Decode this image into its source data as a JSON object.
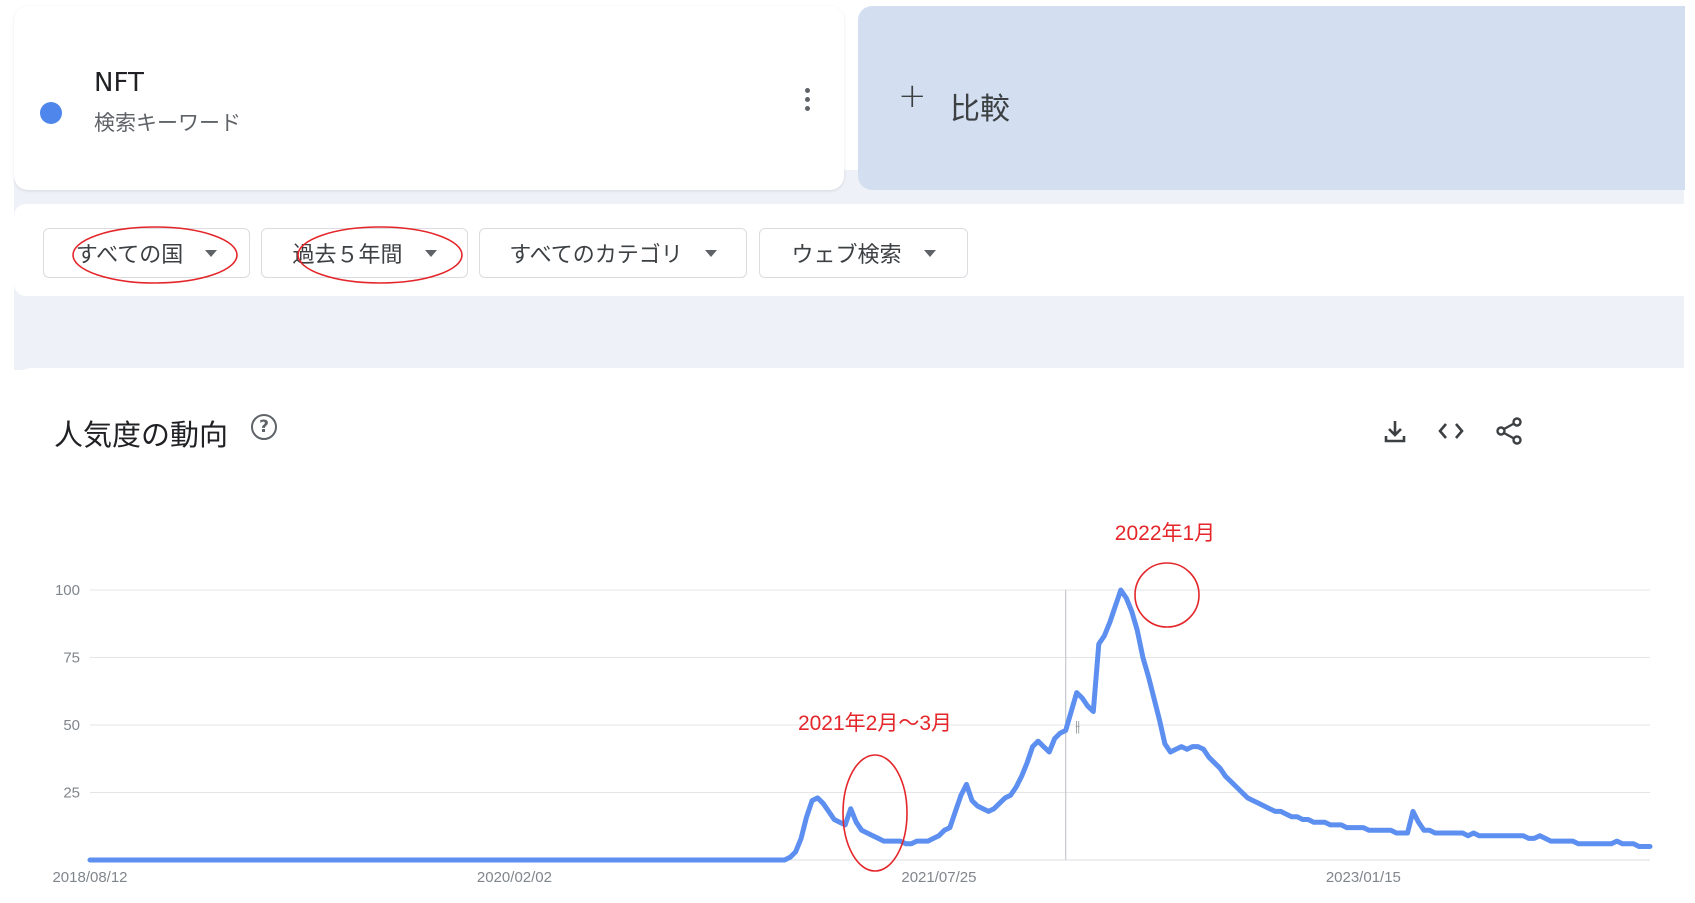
{
  "keyword": {
    "term": "NFT",
    "subtitle": "検索キーワード",
    "color": "#4f86ec",
    "menu_icon": "more-vert-icon"
  },
  "compare": {
    "plus": "+",
    "label": "比較"
  },
  "filters": [
    {
      "label": "すべての国"
    },
    {
      "label": "過去５年間"
    },
    {
      "label": "すべてのカテゴリ"
    },
    {
      "label": "ウェブ検索"
    }
  ],
  "chart_section": {
    "title": "人気度の動向",
    "help_icon": "help-circle-icon",
    "tools": [
      "download-icon",
      "embed-code-icon",
      "share-icon"
    ]
  },
  "annotations": {
    "peak_label": "2022年1月",
    "early_label": "2021年2月〜3月"
  },
  "chart_data": {
    "type": "line",
    "title": "",
    "xlabel": "",
    "ylabel": "",
    "ylim": [
      0,
      100
    ],
    "yticks": [
      25,
      50,
      75,
      100
    ],
    "xtick_labels": [
      "2018/08/12",
      "2020/02/02",
      "2021/07/25",
      "2023/01/15"
    ],
    "xtick_positions": [
      0,
      77,
      154,
      231
    ],
    "grid": true,
    "line_color": "#5d8ff0",
    "hover_marker_week": 177,
    "series": [
      {
        "values": [
          0,
          0,
          0,
          0,
          0,
          0,
          0,
          0,
          0,
          0,
          0,
          0,
          0,
          0,
          0,
          0,
          0,
          0,
          0,
          0,
          0,
          0,
          0,
          0,
          0,
          0,
          0,
          0,
          0,
          0,
          0,
          0,
          0,
          0,
          0,
          0,
          0,
          0,
          0,
          0,
          0,
          0,
          0,
          0,
          0,
          0,
          0,
          0,
          0,
          0,
          0,
          0,
          0,
          0,
          0,
          0,
          0,
          0,
          0,
          0,
          0,
          0,
          0,
          0,
          0,
          0,
          0,
          0,
          0,
          0,
          0,
          0,
          0,
          0,
          0,
          0,
          0,
          0,
          0,
          0,
          0,
          0,
          0,
          0,
          0,
          0,
          0,
          0,
          0,
          0,
          0,
          0,
          0,
          0,
          0,
          0,
          0,
          0,
          0,
          0,
          0,
          0,
          0,
          0,
          0,
          0,
          0,
          0,
          0,
          0,
          0,
          0,
          0,
          0,
          0,
          0,
          0,
          0,
          0,
          0,
          0,
          0,
          0,
          0,
          0,
          0,
          0,
          1,
          3,
          8,
          16,
          22,
          23,
          21,
          18,
          15,
          14,
          13,
          19,
          14,
          11,
          10,
          9,
          8,
          7,
          7,
          7,
          7,
          6,
          6,
          7,
          7,
          7,
          8,
          9,
          11,
          12,
          18,
          24,
          28,
          22,
          20,
          19,
          18,
          19,
          21,
          23,
          24,
          27,
          31,
          36,
          42,
          44,
          42,
          40,
          45,
          47,
          48,
          55,
          62,
          60,
          57,
          55,
          80,
          83,
          88,
          94,
          100,
          97,
          92,
          85,
          75,
          68,
          60,
          52,
          43,
          40,
          41,
          42,
          41,
          42,
          42,
          41,
          38,
          36,
          34,
          31,
          29,
          27,
          25,
          23,
          22,
          21,
          20,
          19,
          18,
          18,
          17,
          16,
          16,
          15,
          15,
          14,
          14,
          14,
          13,
          13,
          13,
          12,
          12,
          12,
          12,
          11,
          11,
          11,
          11,
          11,
          10,
          10,
          10,
          18,
          14,
          11,
          11,
          10,
          10,
          10,
          10,
          10,
          10,
          9,
          10,
          9,
          9,
          9,
          9,
          9,
          9,
          9,
          9,
          9,
          8,
          8,
          9,
          8,
          7,
          7,
          7,
          7,
          7,
          6,
          6,
          6,
          6,
          6,
          6,
          6,
          7,
          6,
          6,
          6,
          5,
          5,
          5
        ]
      }
    ]
  }
}
